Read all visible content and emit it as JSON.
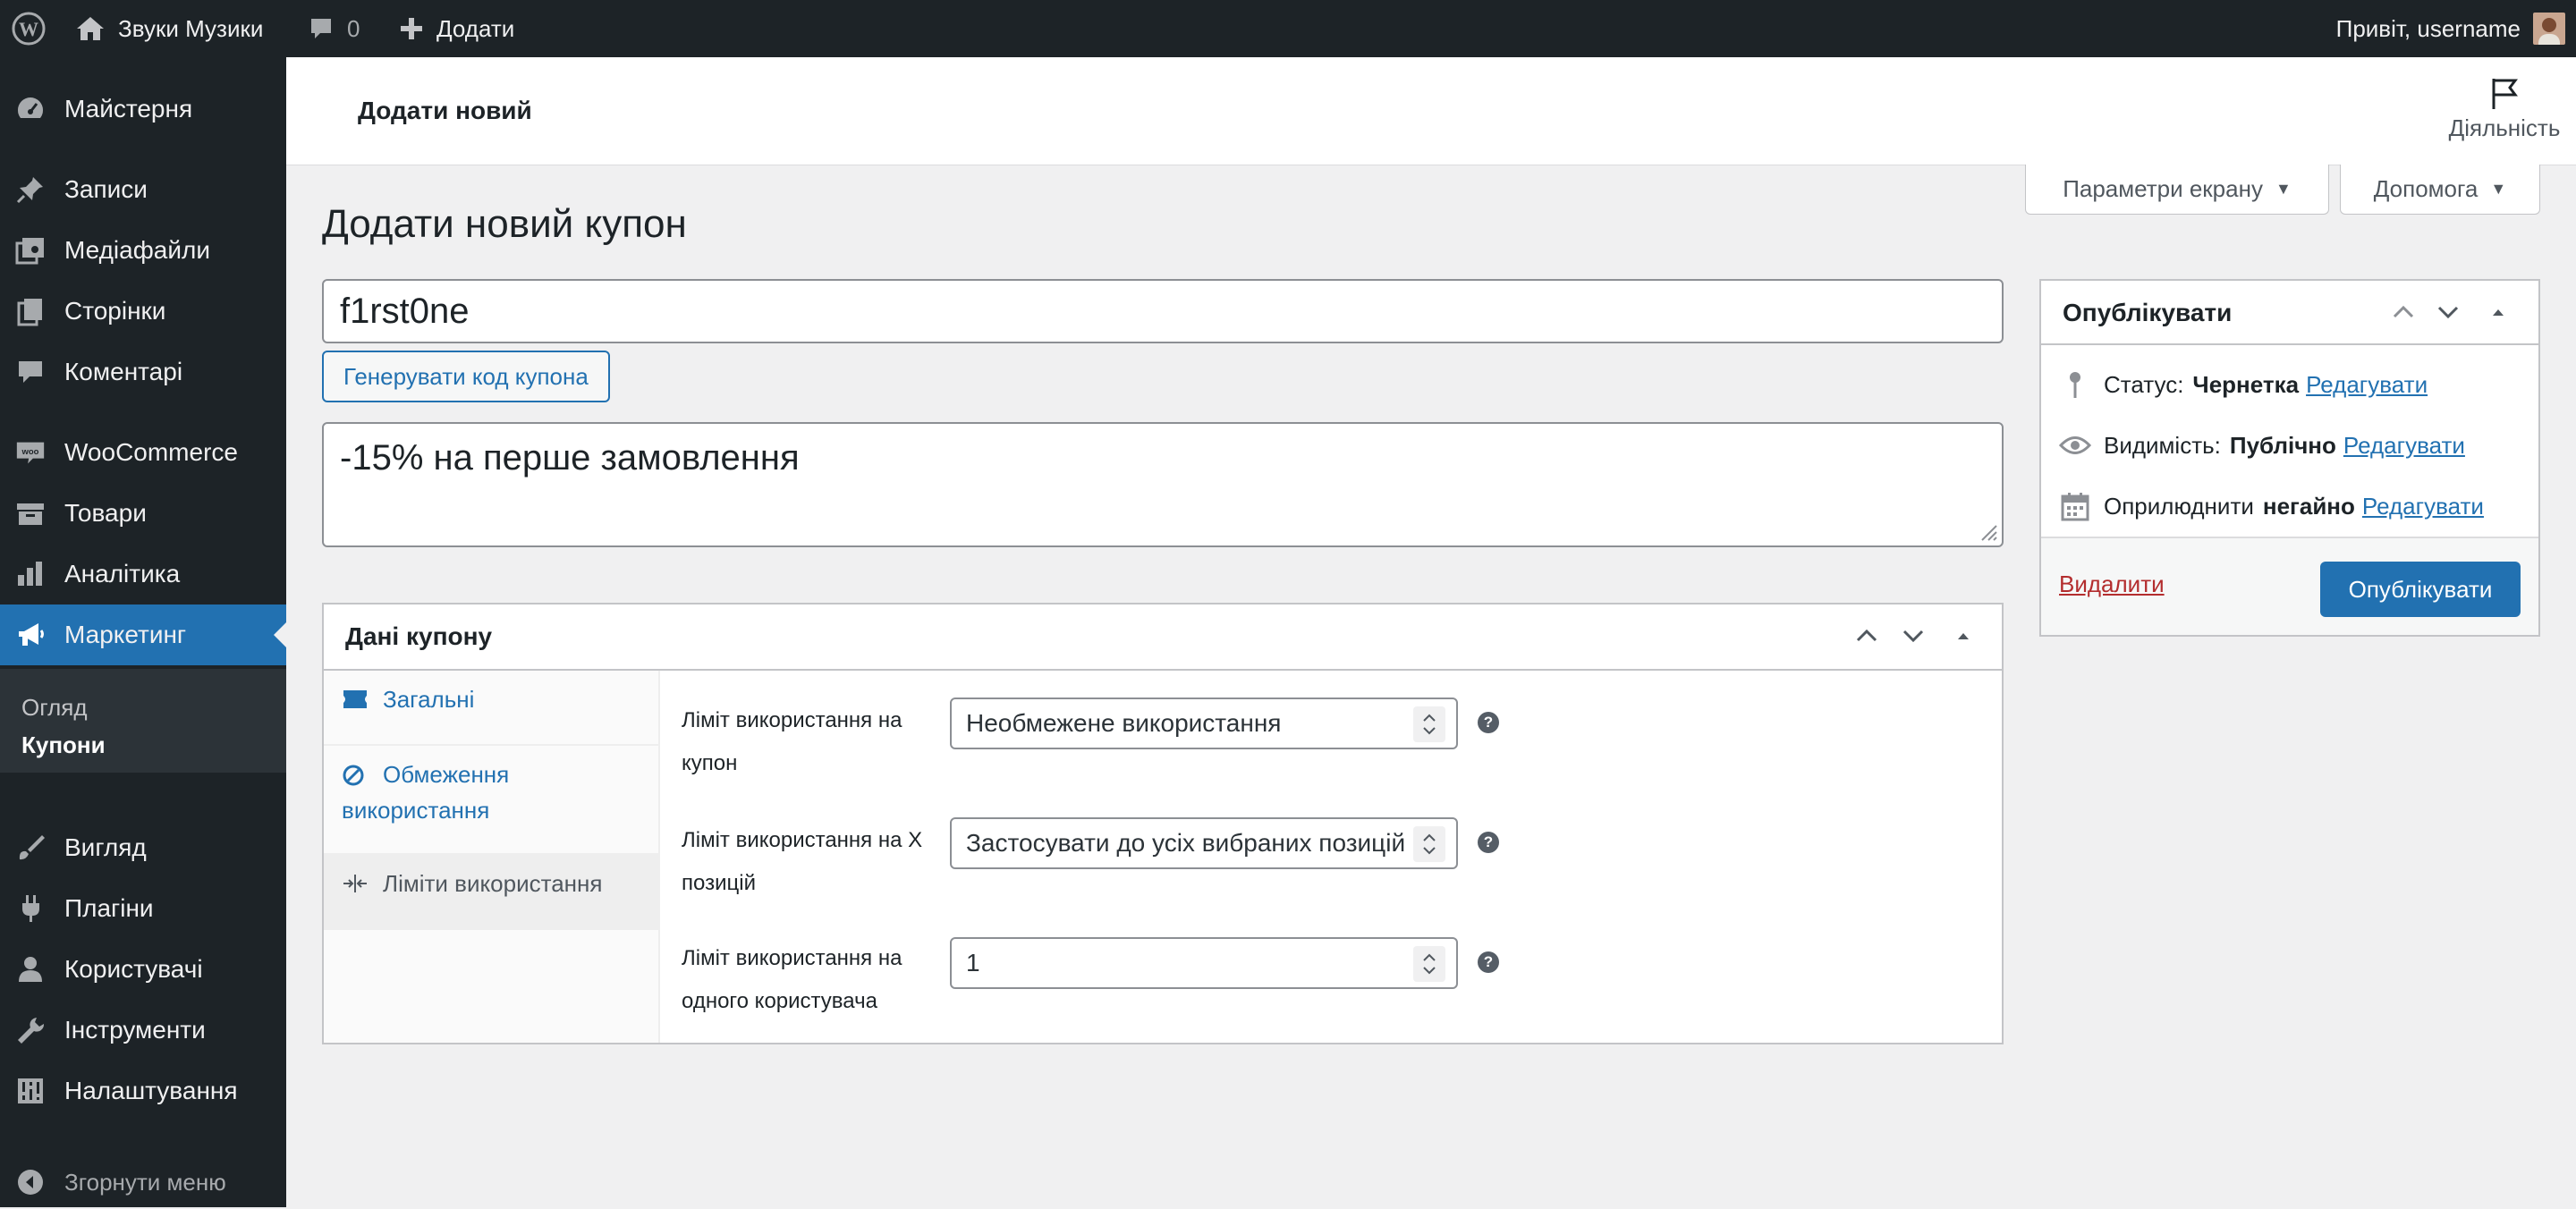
{
  "admin_bar": {
    "site_name": "Звуки Музики",
    "comments_count": "0",
    "new_label": "Додати",
    "greeting": "Привіт, username"
  },
  "menu": {
    "items": [
      {
        "label": "Майстерня",
        "icon": "dashboard-icon"
      },
      {
        "label": "Записи",
        "icon": "pin-icon"
      },
      {
        "label": "Медіафайли",
        "icon": "media-icon"
      },
      {
        "label": "Сторінки",
        "icon": "pages-icon"
      },
      {
        "label": "Коментарі",
        "icon": "comment-icon"
      },
      {
        "label": "WooCommerce",
        "icon": "woo-icon"
      },
      {
        "label": "Товари",
        "icon": "archive-icon"
      },
      {
        "label": "Аналітика",
        "icon": "chart-bar-icon"
      },
      {
        "label": "Маркетинг",
        "icon": "megaphone-icon"
      },
      {
        "label": "Вигляд",
        "icon": "brush-icon"
      },
      {
        "label": "Плагіни",
        "icon": "plugin-icon"
      },
      {
        "label": "Користувачі",
        "icon": "users-icon"
      },
      {
        "label": "Інструменти",
        "icon": "wrench-icon"
      },
      {
        "label": "Налаштування",
        "icon": "settings-icon"
      }
    ],
    "submenu": [
      "Огляд",
      "Купони"
    ],
    "collapse_label": "Згорнути меню"
  },
  "header": {
    "title": "Додати новий",
    "activity_label": "Діяльність"
  },
  "screen_meta": {
    "screen_options": "Параметри екрану",
    "help": "Допомога"
  },
  "page_title": "Додати новий купон",
  "coupon": {
    "code": "f1rst0ne",
    "generate_label": "Генерувати код купона",
    "description": "-15% на перше замовлення"
  },
  "coupon_data": {
    "title": "Дані купону",
    "tabs": [
      "Загальні",
      "Обмеження використання",
      "Ліміти використання"
    ],
    "fields": [
      {
        "label": "Ліміт використання на купон",
        "value": "Необмежене використання"
      },
      {
        "label": "Ліміт використання на X позицій",
        "value": "Застосувати до усіх вибраних позицій"
      },
      {
        "label": "Ліміт використання на одного користувача",
        "value": "1"
      }
    ]
  },
  "publish": {
    "title": "Опублікувати",
    "status_label": "Статус:",
    "status_value": "Чернетка",
    "visibility_label": "Видимість:",
    "visibility_value": "Публічно",
    "publish_label": "Оприлюднити",
    "publish_value": "негайно",
    "edit_label": "Редагувати",
    "delete_label": "Видалити",
    "publish_button": "Опублікувати"
  },
  "colors": {
    "accent": "#2271b1",
    "menu_bg": "#1d2327",
    "danger": "#b32d2e"
  }
}
